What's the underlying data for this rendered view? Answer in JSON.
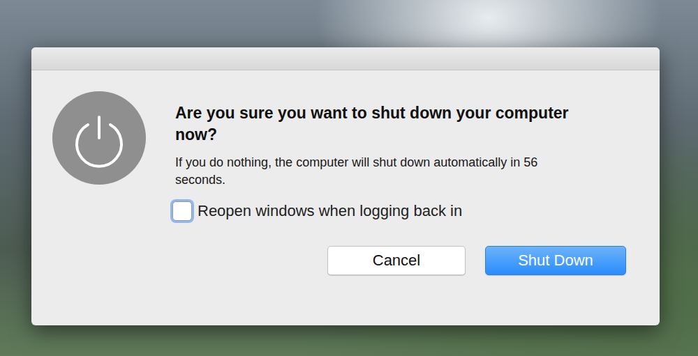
{
  "dialog": {
    "title": "Are you sure you want to shut down your computer now?",
    "message": "If you do nothing, the computer will shut down automatically in 56 seconds.",
    "checkbox": {
      "label": "Reopen windows when logging back in",
      "checked": false,
      "focused": true
    },
    "buttons": [
      {
        "label": "Cancel",
        "default": false
      },
      {
        "label": "Shut Down",
        "default": true
      }
    ]
  }
}
